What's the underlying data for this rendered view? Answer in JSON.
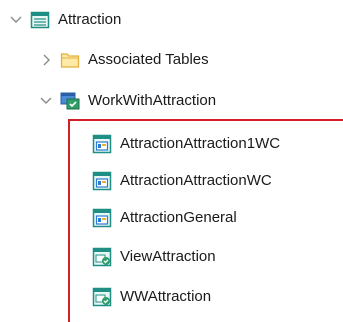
{
  "tree": {
    "root": {
      "label": "Attraction",
      "icon": "table-icon",
      "expanded": true
    },
    "associated_tables": {
      "label": "Associated Tables",
      "icon": "folder-icon",
      "expanded": false
    },
    "work_with": {
      "label": "WorkWithAttraction",
      "icon": "workwith-pattern-icon",
      "expanded": true
    },
    "children": [
      {
        "label": "AttractionAttraction1WC",
        "icon": "web-component-icon"
      },
      {
        "label": "AttractionAttractionWC",
        "icon": "web-component-icon"
      },
      {
        "label": "AttractionGeneral",
        "icon": "web-component-icon"
      },
      {
        "label": "ViewAttraction",
        "icon": "web-panel-icon"
      },
      {
        "label": "WWAttraction",
        "icon": "web-panel-icon"
      }
    ]
  },
  "colors": {
    "highlight_border": "#d51f28",
    "chevron": "#8a8a8a",
    "icon_teal": "#1f8f86",
    "icon_blue": "#2a7ad6",
    "folder_fill": "#ffe9a6",
    "folder_stroke": "#e2b23c"
  }
}
